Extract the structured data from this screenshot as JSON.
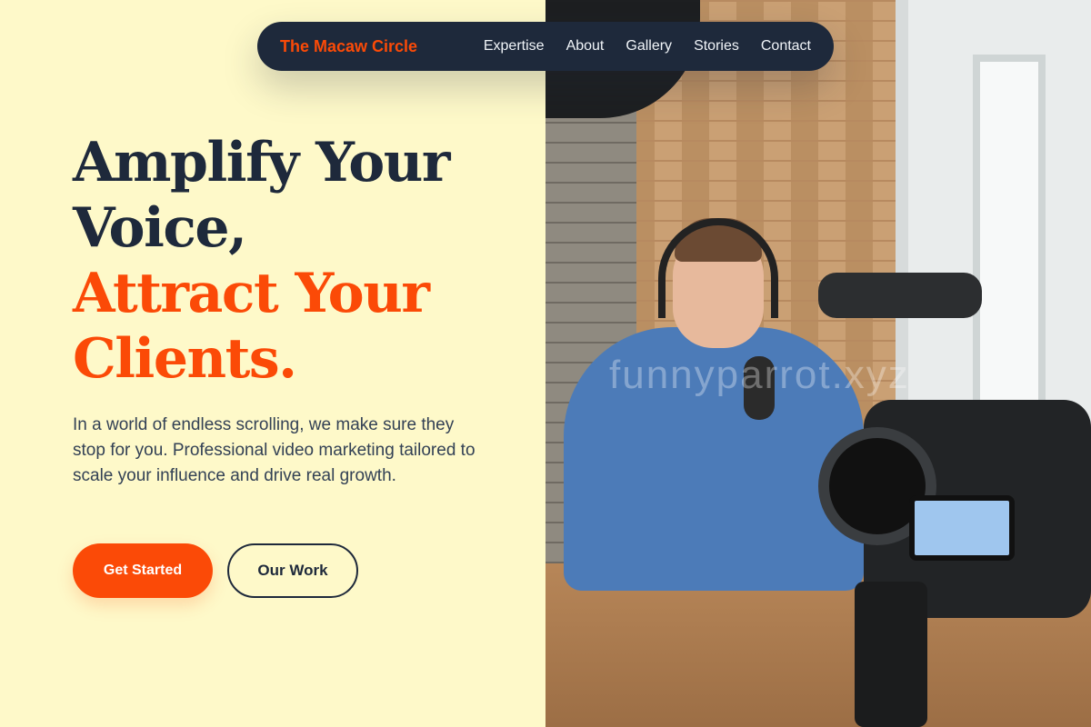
{
  "colors": {
    "background": "#fef9c9",
    "navy": "#1e293b",
    "accent": "#fb4a07",
    "body_text": "#334155"
  },
  "nav": {
    "brand": "The Macaw Circle",
    "links": [
      "Expertise",
      "About",
      "Gallery",
      "Stories",
      "Contact"
    ]
  },
  "hero": {
    "headline_line1": "Amplify Your",
    "headline_line2": "Voice,",
    "headline_line3": "Attract Your",
    "headline_line4": "Clients.",
    "lead": "In a world of endless scrolling, we make sure they stop for you. Professional video marketing tailored to scale your influence and drive real growth.",
    "primary_cta": "Get Started",
    "secondary_cta": "Our Work"
  },
  "photo": {
    "watermark": "funnyparrot.xyz"
  }
}
